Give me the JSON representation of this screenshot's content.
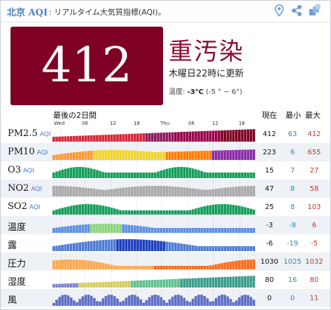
{
  "header": {
    "city": "北京",
    "aqi_tag": "AQI",
    "subtitle": ": リアルタイム大気質指標(AQI)。"
  },
  "current": {
    "aqi": "412",
    "level": "重汚染",
    "updated": "木曜日22時に更新",
    "temp_label": "温度: ",
    "temp_value": "-3°C",
    "temp_range": " (-5 ° ~ 6°)"
  },
  "chart": {
    "period_label": "最後の2日間",
    "col_current": "現在",
    "col_min": "最小",
    "col_max": "最大",
    "tick_labels": [
      "Wed",
      "06",
      "12",
      "18",
      "Thu",
      "06",
      "12",
      "18"
    ],
    "rows": [
      {
        "name": "PM2.5",
        "aqi": "AQI",
        "current": "412",
        "min": "63",
        "max": "412"
      },
      {
        "name": "PM10",
        "aqi": "AQI",
        "current": "223",
        "min": "6",
        "max": "655"
      },
      {
        "name": "O3",
        "aqi": "AQI",
        "current": "15",
        "min": "7",
        "max": "27"
      },
      {
        "name": "NO2",
        "aqi": "AQI",
        "current": "47",
        "min": "8",
        "max": "58"
      },
      {
        "name": "SO2",
        "aqi": "AQI",
        "current": "25",
        "min": "8",
        "max": "103"
      },
      {
        "name": "温度",
        "aqi": "",
        "current": "-3",
        "min": "-8",
        "max": "6"
      },
      {
        "name": "露",
        "aqi": "",
        "current": "-6",
        "min": "-19",
        "max": "-5"
      },
      {
        "name": "圧力",
        "aqi": "",
        "current": "1030",
        "min": "1025",
        "max": "1032"
      },
      {
        "name": "湿度",
        "aqi": "",
        "current": "80",
        "min": "16",
        "max": "80"
      },
      {
        "name": "風",
        "aqi": "",
        "current": "0",
        "min": "0",
        "max": "11"
      }
    ]
  },
  "colors": {
    "hazardous": "#7e0023",
    "level_text": "#8b1032",
    "link_blue": "#4a7fc0",
    "min_color": "#2a8fb0",
    "max_color": "#c0392b"
  },
  "icons": [
    "map-pin-icon",
    "share-icon",
    "widget-icon"
  ]
}
